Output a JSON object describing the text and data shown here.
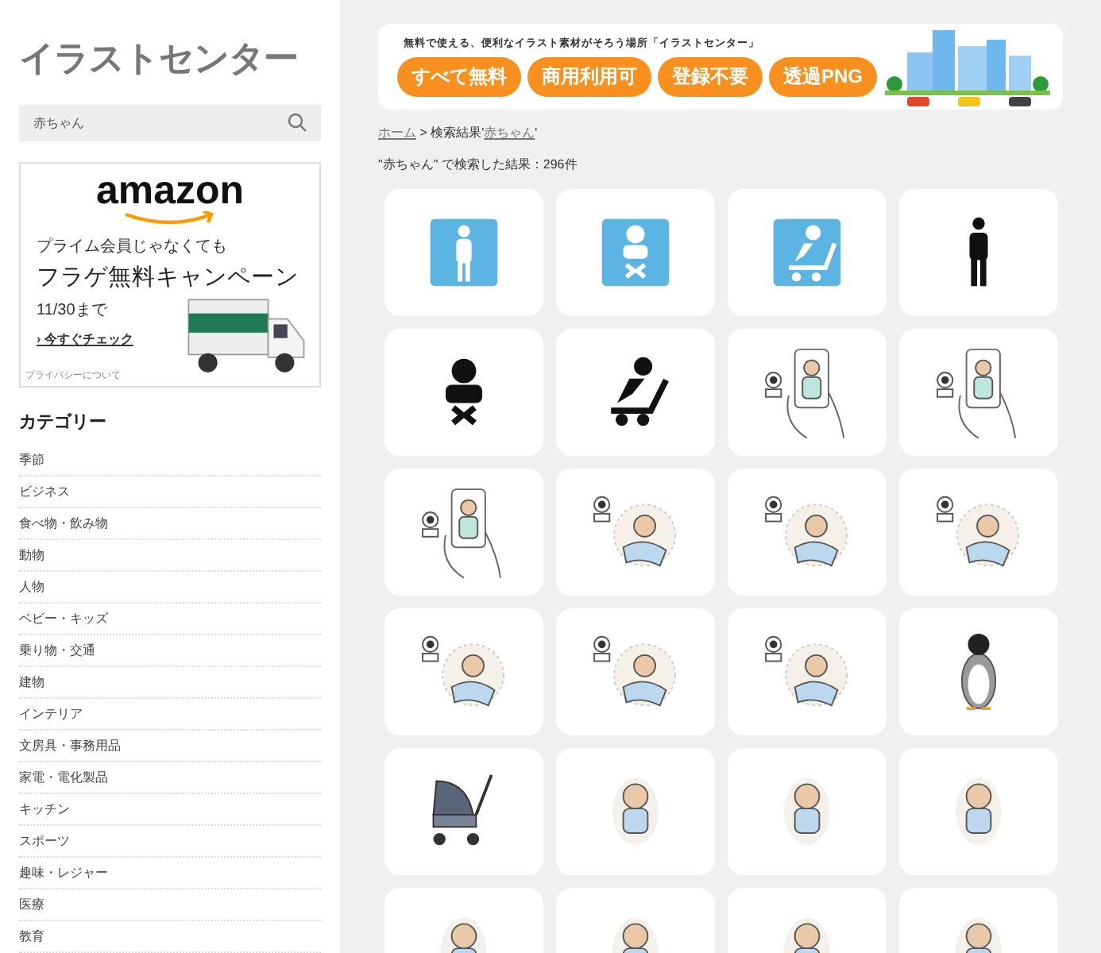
{
  "sidebar": {
    "logo": "イラストセンター",
    "search": {
      "value": "赤ちゃん"
    },
    "ad": {
      "brand": "amazon",
      "line1": "プライム会員じゃなくても",
      "line2": "フラゲ無料キャンペーン",
      "date": "11/30まで",
      "link": "› 今すぐチェック",
      "privacy": "プライバシーについて"
    },
    "categories_title": "カテゴリー",
    "categories": [
      "季節",
      "ビジネス",
      "食べ物・飲み物",
      "動物",
      "人物",
      "ベビー・キッズ",
      "乗り物・交通",
      "建物",
      "インテリア",
      "文房具・事務用品",
      "家電・電化製品",
      "キッチン",
      "スポーツ",
      "趣味・レジャー",
      "医療",
      "教育"
    ]
  },
  "banner": {
    "tagline": "無料で使える、便利なイラスト素材がそろう場所「イラストセンター」",
    "badges": [
      "すべて無料",
      "商用利用可",
      "登録不要",
      "透過PNG"
    ]
  },
  "breadcrumb": {
    "home": "ホーム",
    "separator": ">",
    "prefix": "検索結果'",
    "term": "赤ちゃん",
    "suffix": "'"
  },
  "result_count": "\"赤ちゃん\" で検索した結果：296件",
  "tiles": [
    {
      "kind": "person-sign"
    },
    {
      "kind": "baby-sign"
    },
    {
      "kind": "stroller-sign"
    },
    {
      "kind": "person-pictogram"
    },
    {
      "kind": "baby-pictogram"
    },
    {
      "kind": "stroller-pictogram"
    },
    {
      "kind": "monitor"
    },
    {
      "kind": "monitor"
    },
    {
      "kind": "monitor"
    },
    {
      "kind": "sleeping"
    },
    {
      "kind": "sleeping"
    },
    {
      "kind": "sleeping"
    },
    {
      "kind": "sleeping"
    },
    {
      "kind": "sleeping"
    },
    {
      "kind": "sleeping"
    },
    {
      "kind": "penguin"
    },
    {
      "kind": "stroller"
    },
    {
      "kind": "baby"
    },
    {
      "kind": "baby"
    },
    {
      "kind": "baby"
    },
    {
      "kind": "baby"
    },
    {
      "kind": "baby"
    },
    {
      "kind": "baby"
    },
    {
      "kind": "baby"
    }
  ]
}
